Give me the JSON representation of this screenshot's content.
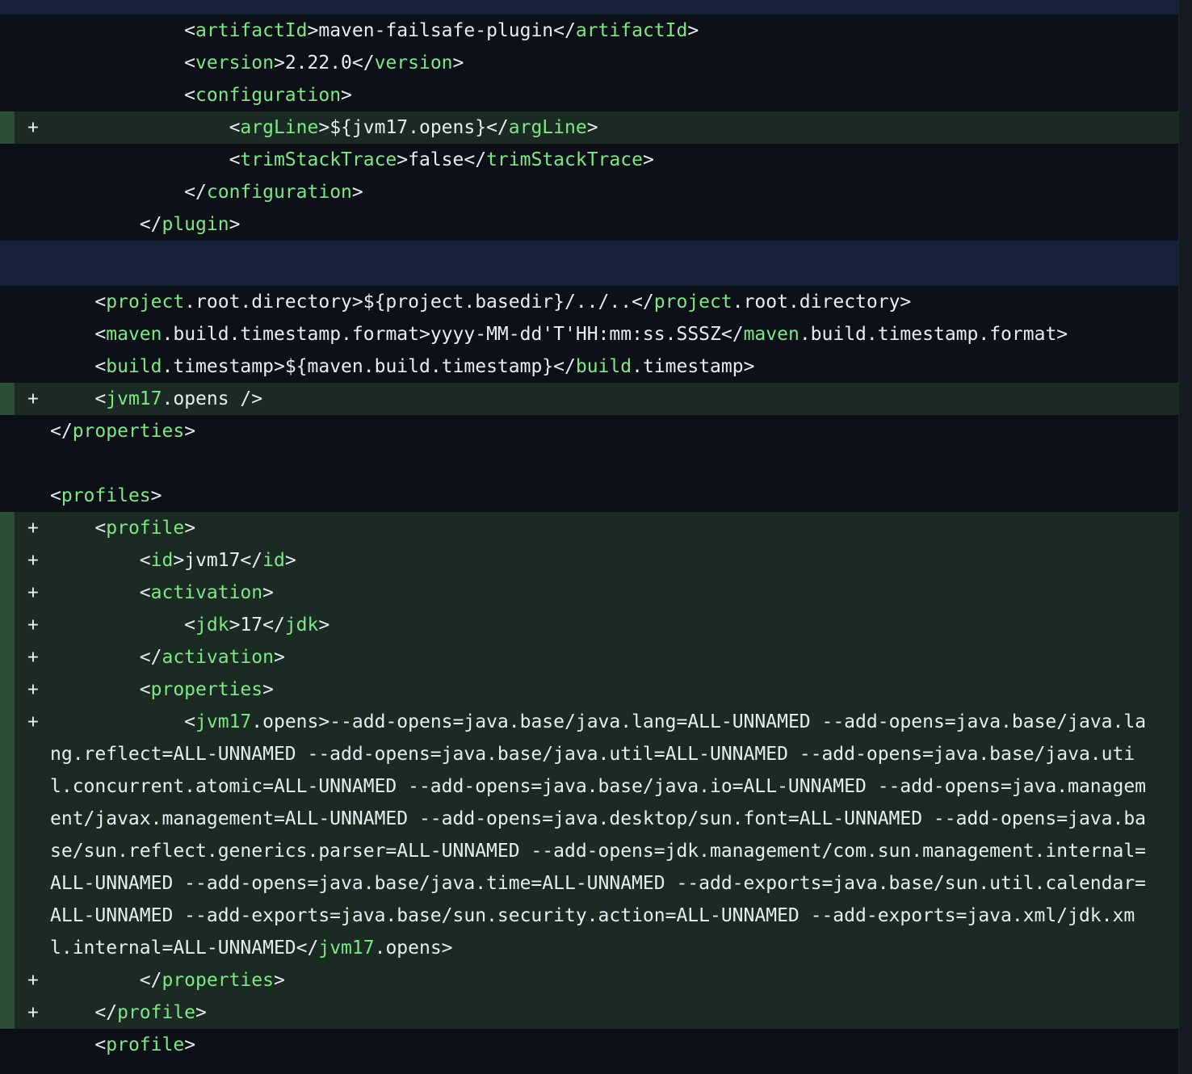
{
  "diff": {
    "added_marker": "+",
    "lines": [
      {
        "kind": "context",
        "text": "            <artifactId>maven-failsafe-plugin</artifactId>"
      },
      {
        "kind": "context",
        "text": "            <version>2.22.0</version>"
      },
      {
        "kind": "context",
        "text": "            <configuration>"
      },
      {
        "kind": "added",
        "text": "                <argLine>${jvm17.opens}</argLine>"
      },
      {
        "kind": "context",
        "text": "                <trimStackTrace>false</trimStackTrace>"
      },
      {
        "kind": "context",
        "text": "            </configuration>"
      },
      {
        "kind": "context",
        "text": "        </plugin>"
      },
      {
        "kind": "context",
        "text": "    <project.root.directory>${project.basedir}/../..</project.root.directory>"
      },
      {
        "kind": "context",
        "text": "    <maven.build.timestamp.format>yyyy-MM-dd'T'HH:mm:ss.SSSZ</maven.build.timestamp.format>"
      },
      {
        "kind": "context",
        "text": "    <build.timestamp>${maven.build.timestamp}</build.timestamp>"
      },
      {
        "kind": "added",
        "text": "    <jvm17.opens />"
      },
      {
        "kind": "context",
        "text": "</properties>"
      },
      {
        "kind": "context",
        "text": ""
      },
      {
        "kind": "context",
        "text": "<profiles>"
      },
      {
        "kind": "added",
        "text": "    <profile>"
      },
      {
        "kind": "added",
        "text": "        <id>jvm17</id>"
      },
      {
        "kind": "added",
        "text": "        <activation>"
      },
      {
        "kind": "added",
        "text": "            <jdk>17</jdk>"
      },
      {
        "kind": "added",
        "text": "        </activation>"
      },
      {
        "kind": "added",
        "text": "        <properties>"
      },
      {
        "kind": "added",
        "text": "            <jvm17.opens>--add-opens=java.base/java.lang=ALL-UNNAMED --add-opens=java.base/java.lang.reflect=ALL-UNNAMED --add-opens=java.base/java.util=ALL-UNNAMED --add-opens=java.base/java.util.concurrent.atomic=ALL-UNNAMED --add-opens=java.base/java.io=ALL-UNNAMED --add-opens=java.management/javax.management=ALL-UNNAMED --add-opens=java.desktop/sun.font=ALL-UNNAMED --add-opens=java.base/sun.reflect.generics.parser=ALL-UNNAMED --add-opens=jdk.management/com.sun.management.internal=ALL-UNNAMED --add-opens=java.base/java.time=ALL-UNNAMED --add-exports=java.base/sun.util.calendar=ALL-UNNAMED --add-exports=java.base/sun.security.action=ALL-UNNAMED --add-exports=java.xml/jdk.xml.internal=ALL-UNNAMED</jvm17.opens>"
      },
      {
        "kind": "added",
        "text": "        </properties>"
      },
      {
        "kind": "added",
        "text": "    </profile>"
      },
      {
        "kind": "context",
        "text": "    <profile>"
      }
    ]
  }
}
